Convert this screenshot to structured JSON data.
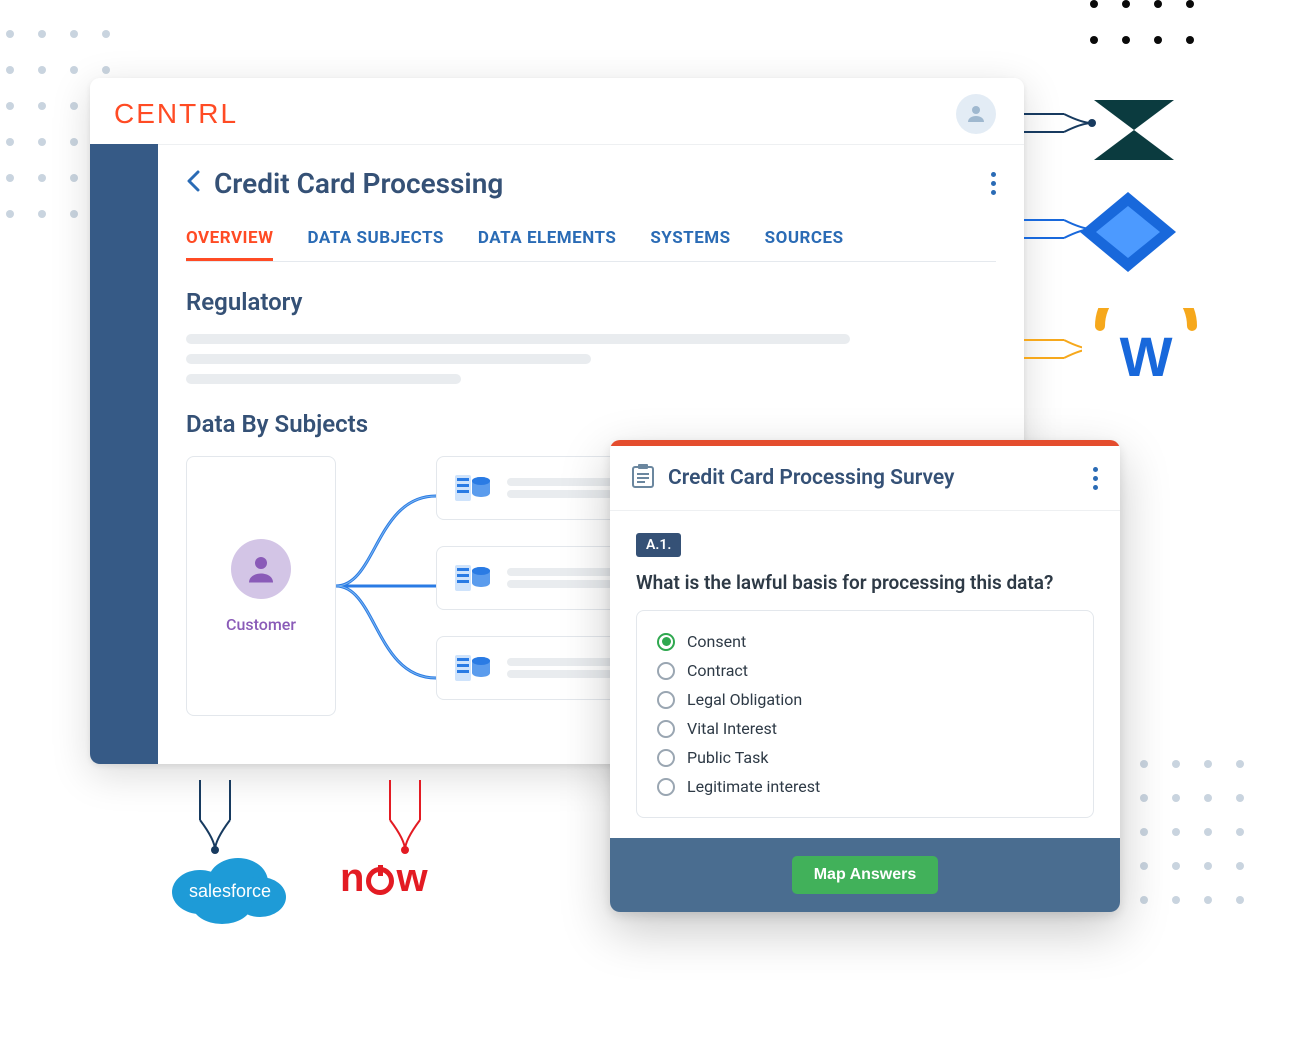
{
  "brand": "CENTRL",
  "page_title": "Credit Card Processing",
  "tabs": [
    {
      "label": "OVERVIEW",
      "active": true
    },
    {
      "label": "DATA SUBJECTS",
      "active": false
    },
    {
      "label": "DATA ELEMENTS",
      "active": false
    },
    {
      "label": "SYSTEMS",
      "active": false
    },
    {
      "label": "SOURCES",
      "active": false
    }
  ],
  "section_regulatory": "Regulatory",
  "section_dbs": "Data By Subjects",
  "subject": {
    "label": "Customer"
  },
  "survey": {
    "title": "Credit Card Processing Survey",
    "question_id": "A.1.",
    "question_text": "What is the lawful basis for processing this data?",
    "options": [
      {
        "label": "Consent",
        "selected": true
      },
      {
        "label": "Contract",
        "selected": false
      },
      {
        "label": "Legal Obligation",
        "selected": false
      },
      {
        "label": "Vital Interest",
        "selected": false
      },
      {
        "label": "Public Task",
        "selected": false
      },
      {
        "label": "Legitimate interest",
        "selected": false
      }
    ],
    "action_label": "Map Answers"
  },
  "integrations": {
    "salesforce": "salesforce",
    "servicenow": "now",
    "zendesk": "Z",
    "jira": "jira",
    "workday": "W"
  }
}
